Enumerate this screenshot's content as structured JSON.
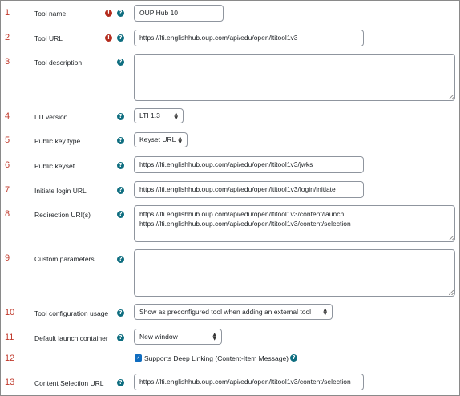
{
  "rows": {
    "tool_name": {
      "num": "1",
      "label": "Tool name",
      "value": "OUP Hub 10"
    },
    "tool_url": {
      "num": "2",
      "label": "Tool URL",
      "value": "https://lti.englishhub.oup.com/api/edu/open/ltitool1v3"
    },
    "tool_description": {
      "num": "3",
      "label": "Tool description",
      "value": ""
    },
    "lti_version": {
      "num": "4",
      "label": "LTI version",
      "value": "LTI 1.3"
    },
    "public_key_type": {
      "num": "5",
      "label": "Public key type",
      "value": "Keyset URL"
    },
    "public_keyset": {
      "num": "6",
      "label": "Public keyset",
      "value": "https://lti.englishhub.oup.com/api/edu/open/ltitool1v3/jwks"
    },
    "initiate_login_url": {
      "num": "7",
      "label": "Initiate login URL",
      "value": "https://lti.englishhub.oup.com/api/edu/open/ltitool1v3/login/initiate"
    },
    "redirection_uris": {
      "num": "8",
      "label": "Redirection URI(s)",
      "lines": [
        "https://lti.englishhub.oup.com/api/edu/open/ltitool1v3/content/launch",
        "https://lti.englishhub.oup.com/api/edu/open/ltitool1v3/content/selection"
      ]
    },
    "custom_parameters": {
      "num": "9",
      "label": "Custom parameters",
      "value": ""
    },
    "tool_configuration_usage": {
      "num": "10",
      "label": "Tool configuration usage",
      "value": "Show as preconfigured tool when adding an external tool"
    },
    "default_launch_container": {
      "num": "11",
      "label": "Default launch container",
      "value": "New window"
    },
    "deep_linking": {
      "num": "12",
      "label": "Supports Deep Linking (Content-Item Message)",
      "checked": true
    },
    "content_selection_url": {
      "num": "13",
      "label": "Content Selection URL",
      "value": "https://lti.englishhub.oup.com/api/edu/open/ltitool1v3/content/selection"
    }
  },
  "icons": {
    "help": "question-circle-icon",
    "required": "exclamation-circle-icon",
    "caret": "up-down-caret-icon",
    "check": "checkmark-icon"
  },
  "colors": {
    "number_red": "#c0392b",
    "help_teal": "#0f6e80",
    "required_red": "#b42c1e",
    "checkbox_blue": "#0f6cbf"
  }
}
